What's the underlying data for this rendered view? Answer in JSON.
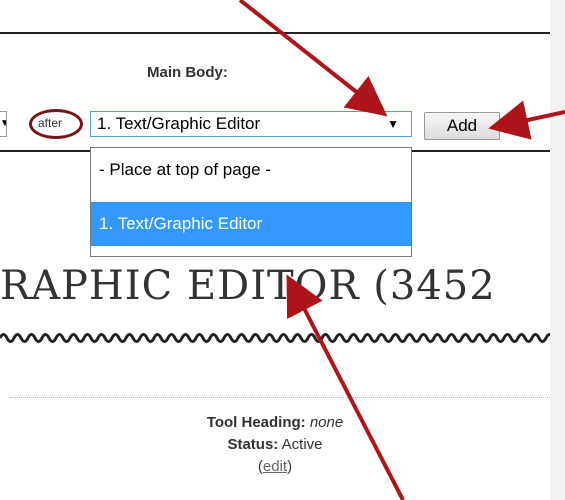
{
  "form": {
    "section_label": "Main Body:",
    "position_label": "after",
    "selected_value": "1. Text/Graphic Editor",
    "arrow_glyph": "▼",
    "add_label": "Add",
    "options": [
      "- Place at top of page -",
      "1. Text/Graphic Editor"
    ],
    "highlighted_option_index": 1
  },
  "section": {
    "title": "RAPHIC EDITOR (3452"
  },
  "meta": {
    "tool_heading_label": "Tool Heading:",
    "tool_heading_value": "none",
    "status_label": "Status:",
    "status_value": "Active",
    "edit_open": "(",
    "edit_label": "edit",
    "edit_close": ")"
  },
  "colors": {
    "annotation": "#b0141b",
    "circle": "#7a1418",
    "highlight": "#3399ff",
    "focus_border": "#5b9bd5"
  }
}
